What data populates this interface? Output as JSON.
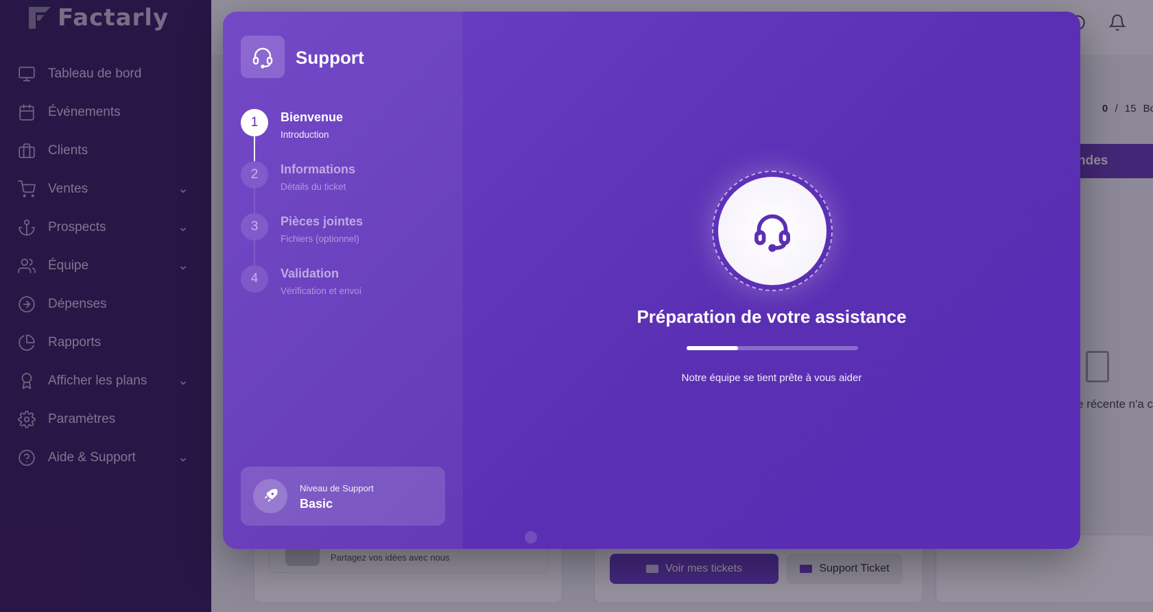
{
  "app": {
    "logo_text": "Factarly"
  },
  "sidebar": {
    "items": [
      {
        "label": "Tableau de bord",
        "icon": "monitor-icon",
        "expandable": false
      },
      {
        "label": "Événements",
        "icon": "calendar-icon",
        "expandable": false
      },
      {
        "label": "Clients",
        "icon": "briefcase-icon",
        "expandable": false
      },
      {
        "label": "Ventes",
        "icon": "cart-icon",
        "expandable": true
      },
      {
        "label": "Prospects",
        "icon": "anchor-icon",
        "expandable": true
      },
      {
        "label": "Équipe",
        "icon": "users-icon",
        "expandable": true
      },
      {
        "label": "Dépenses",
        "icon": "arrow-circle-icon",
        "expandable": false
      },
      {
        "label": "Rapports",
        "icon": "pie-chart-icon",
        "expandable": false
      },
      {
        "label": "Afficher les plans",
        "icon": "award-icon",
        "expandable": true
      },
      {
        "label": "Paramètres",
        "icon": "gear-icon",
        "expandable": false
      },
      {
        "label": "Aide & Support",
        "icon": "help-circle-icon",
        "expandable": true
      }
    ]
  },
  "background": {
    "usage": {
      "current": "0",
      "separator": "/",
      "max": "15",
      "unit": "Bo"
    },
    "banner_text": "ndes",
    "empty_text": "e récente n'a c",
    "feedback_text": "Partagez vos idées avec nous",
    "buttons": {
      "view_tickets": "Voir mes tickets",
      "support_ticket": "Support Ticket"
    }
  },
  "modal": {
    "title": "Support",
    "steps": [
      {
        "number": "1",
        "title": "Bienvenue",
        "subtitle": "Introduction",
        "active": true
      },
      {
        "number": "2",
        "title": "Informations",
        "subtitle": "Détails du ticket",
        "active": false
      },
      {
        "number": "3",
        "title": "Pièces jointes",
        "subtitle": "Fichiers (optionnel)",
        "active": false
      },
      {
        "number": "4",
        "title": "Validation",
        "subtitle": "Vérification et envoi",
        "active": false
      }
    ],
    "level": {
      "label": "Niveau de Support",
      "value": "Basic"
    },
    "hero": {
      "title": "Préparation de votre assistance",
      "subtitle": "Notre équipe se tient prête à vous aider",
      "progress_percent": 30
    }
  },
  "colors": {
    "sidebar_bg": "#3a2060",
    "modal_accent": "#5b2fb3",
    "primary_button": "#6c3fc4"
  }
}
